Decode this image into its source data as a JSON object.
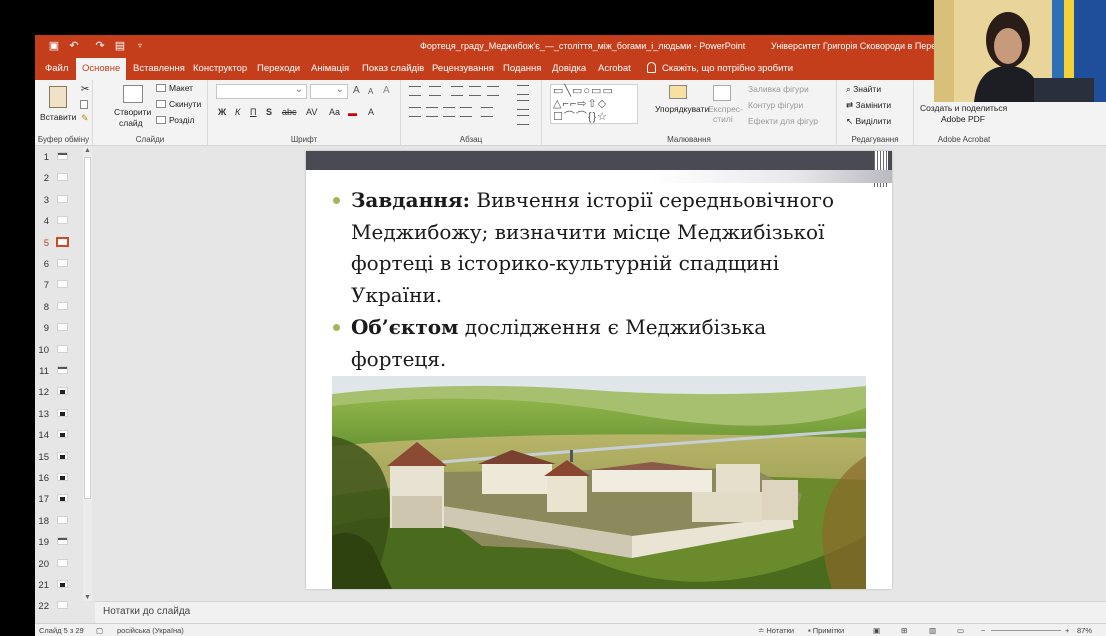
{
  "app": {
    "doc_title": "Фортеця_граду_Меджибож'є_—_століття_між_богами_і_людьми  -  PowerPoint",
    "user_name": "Університет Григорія Сковороди в Пере"
  },
  "tabs": [
    {
      "label": "Файл"
    },
    {
      "label": "Основне"
    },
    {
      "label": "Вставлення"
    },
    {
      "label": "Конструктор"
    },
    {
      "label": "Переходи"
    },
    {
      "label": "Анімація"
    },
    {
      "label": "Показ слайдів"
    },
    {
      "label": "Рецензування"
    },
    {
      "label": "Подання"
    },
    {
      "label": "Довідка"
    },
    {
      "label": "Acrobat"
    }
  ],
  "tell_me": "Скажіть, що потрібно зробити",
  "ribbon": {
    "clipboard": {
      "group": "Буфер обміну",
      "paste": "Вставити"
    },
    "slides": {
      "group": "Слайди",
      "new_slide_1": "Створити",
      "new_slide_2": "слайд",
      "layout": "Макет",
      "reset": "Скинути",
      "section": "Розділ"
    },
    "font": {
      "group": "Шрифт"
    },
    "paragraph": {
      "group": "Абзац"
    },
    "drawing": {
      "group": "Малювання",
      "arrange": "Упорядкувати",
      "styles_1": "Експрес-",
      "styles_2": "стилі",
      "fill": "Заливка фігури",
      "outline": "Контур фігури",
      "effects": "Ефекти для фігур"
    },
    "editing": {
      "group": "Редагування",
      "find": "Знайти",
      "replace": "Замінити",
      "select": "Виділити"
    },
    "acrobat": {
      "group": "Adobe Acrobat",
      "share_1": "Создать и поделиться",
      "share_2": "Adobe PDF"
    }
  },
  "thumbnails": [
    {
      "num": "1"
    },
    {
      "num": "2"
    },
    {
      "num": "3"
    },
    {
      "num": "4"
    },
    {
      "num": "5"
    },
    {
      "num": "6"
    },
    {
      "num": "7"
    },
    {
      "num": "8"
    },
    {
      "num": "9"
    },
    {
      "num": "10"
    },
    {
      "num": "11"
    },
    {
      "num": "12"
    },
    {
      "num": "13"
    },
    {
      "num": "14"
    },
    {
      "num": "15"
    },
    {
      "num": "16"
    },
    {
      "num": "17"
    },
    {
      "num": "18"
    },
    {
      "num": "19"
    },
    {
      "num": "20"
    },
    {
      "num": "21"
    },
    {
      "num": "22"
    }
  ],
  "selected_slide": "5",
  "slide": {
    "bullet1_bold": "Завдання:",
    "bullet1_text": " Вивчення історії середньовічного Меджибожу; визначити місце Меджибізької фортеці в історико-культурній спадщині України.",
    "bullet2_bold": "Об’єктом",
    "bullet2_text": " дослідження є Меджибізька фортеця.",
    "accent_color": "#a6b35c"
  },
  "notes_label": "Нотатки до слайда",
  "status": {
    "slide_info": "Слайд 5 з 29",
    "language": "російська (Україна)",
    "notes": "Нотатки",
    "comments": "Примітки",
    "zoom": "87%"
  },
  "colors": {
    "accent": "#c43e1c"
  }
}
